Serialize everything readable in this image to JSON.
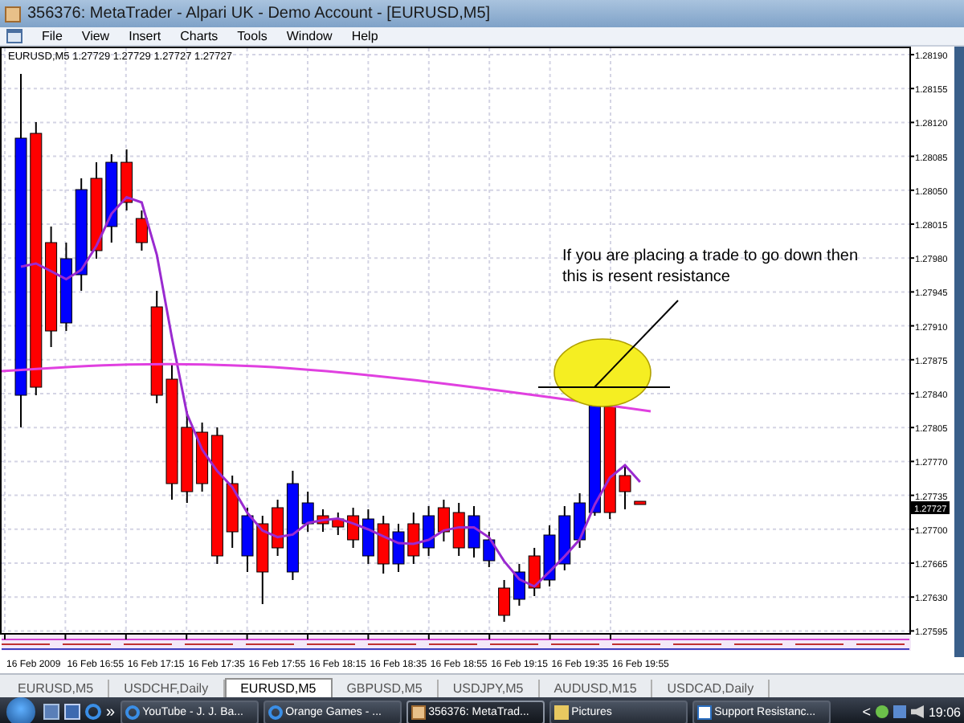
{
  "window": {
    "title": "356376: MetaTrader - Alpari UK - Demo Account - [EURUSD,M5]"
  },
  "menu": [
    {
      "label": "File"
    },
    {
      "label": "View"
    },
    {
      "label": "Insert"
    },
    {
      "label": "Charts"
    },
    {
      "label": "Tools"
    },
    {
      "label": "Window"
    },
    {
      "label": "Help"
    }
  ],
  "chart": {
    "header": "EURUSD,M5  1.27729 1.27729 1.27727 1.27727",
    "price_labels": [
      "1.28190",
      "1.28155",
      "1.28120",
      "1.28085",
      "1.28050",
      "1.28015",
      "1.27980",
      "1.27945",
      "1.27910",
      "1.27875",
      "1.27840",
      "1.27805",
      "1.27770",
      "1.27735",
      "1.27700",
      "1.27665",
      "1.27630",
      "1.27595"
    ],
    "current_price": "1.27727",
    "time_labels": [
      "16 Feb 2009",
      "16 Feb 16:55",
      "16 Feb 17:15",
      "16 Feb 17:35",
      "16 Feb 17:55",
      "16 Feb 18:15",
      "16 Feb 18:35",
      "16 Feb 18:55",
      "16 Feb 19:15",
      "16 Feb 19:35",
      "16 Feb 19:55"
    ],
    "annotation": "If you are placing a trade to go down then this is resent resistance"
  },
  "tabs": [
    {
      "label": "EURUSD,M5",
      "selected": false
    },
    {
      "label": "USDCHF,Daily",
      "selected": false
    },
    {
      "label": "EURUSD,M5",
      "selected": true
    },
    {
      "label": "GBPUSD,M5",
      "selected": false
    },
    {
      "label": "USDJPY,M5",
      "selected": false
    },
    {
      "label": "AUDUSD,M15",
      "selected": false
    },
    {
      "label": "USDCAD,Daily",
      "selected": false
    }
  ],
  "taskbar": {
    "overflow": "»",
    "buttons": [
      {
        "label": "YouTube - J. J. Ba...",
        "kind": "browser",
        "selected": false
      },
      {
        "label": "Orange Games - ...",
        "kind": "browser",
        "selected": false
      },
      {
        "label": "356376: MetaTrad...",
        "kind": "app",
        "selected": true
      },
      {
        "label": "Pictures",
        "kind": "folder",
        "selected": false
      },
      {
        "label": "Support Resistanc...",
        "kind": "document",
        "selected": false
      }
    ],
    "tray_arrow": "<",
    "clock": "19:06"
  }
}
